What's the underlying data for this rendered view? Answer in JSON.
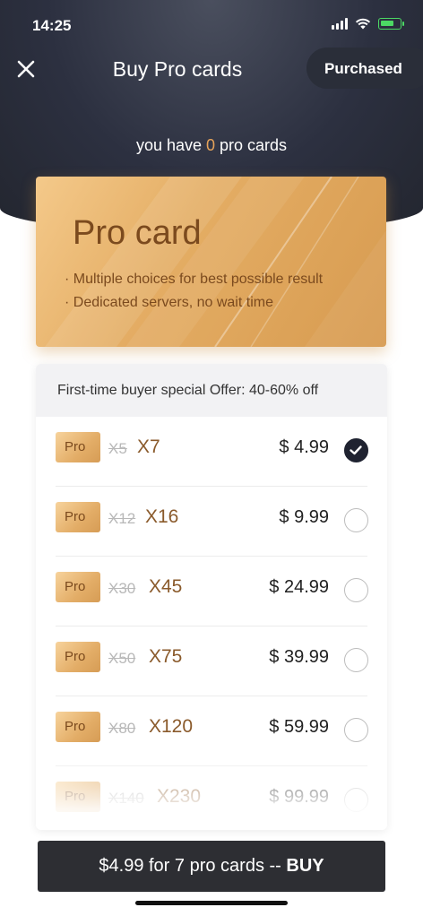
{
  "status_bar": {
    "time": "14:25"
  },
  "header": {
    "title": "Buy Pro cards",
    "purchased_label": "Purchased",
    "count_prefix": "you have ",
    "count": "0",
    "count_suffix": " pro cards"
  },
  "banner": {
    "title": "Pro card",
    "features": [
      "· Multiple choices for best possible result",
      "· Dedicated servers, no wait time"
    ]
  },
  "offer": {
    "header": "First-time buyer special Offer: 40-60% off",
    "options": [
      {
        "badge": "Pro",
        "old_qty": "X5",
        "new_qty": "X7",
        "price": "$ 4.99",
        "selected": true
      },
      {
        "badge": "Pro",
        "old_qty": "X12",
        "new_qty": "X16",
        "price": "$ 9.99",
        "selected": false
      },
      {
        "badge": "Pro",
        "old_qty": "X30",
        "new_qty": "X45",
        "price": "$ 24.99",
        "selected": false
      },
      {
        "badge": "Pro",
        "old_qty": "X50",
        "new_qty": "X75",
        "price": "$ 39.99",
        "selected": false
      },
      {
        "badge": "Pro",
        "old_qty": "X80",
        "new_qty": "X120",
        "price": "$ 59.99",
        "selected": false
      },
      {
        "badge": "Pro",
        "old_qty": "X140",
        "new_qty": "X230",
        "price": "$ 99.99",
        "selected": false
      }
    ]
  },
  "buy_button": {
    "text": "$4.99 for 7 pro cards -- ",
    "action": "BUY"
  },
  "colors": {
    "header_dark": "#2c3040",
    "accent_gold": "#e4ad64",
    "count_highlight": "#e6a35a",
    "qty_brown": "#8a5a2b",
    "buy_button": "#2d2e33"
  },
  "icons": {
    "close": "close-icon",
    "selected": "checkmark-icon",
    "status": [
      "signal-icon",
      "wifi-icon",
      "battery-icon"
    ]
  }
}
